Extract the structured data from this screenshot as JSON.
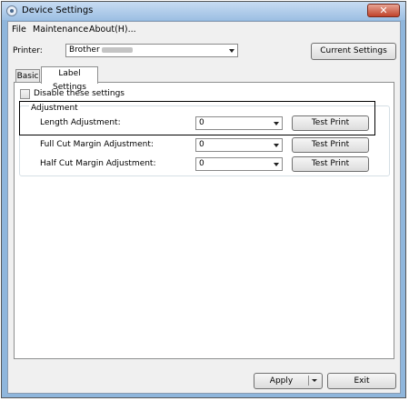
{
  "window": {
    "title": "Device Settings",
    "close_symbol": "✕"
  },
  "menu": [
    "File",
    "Maintenance",
    "About(H)..."
  ],
  "printer": {
    "label": "Printer:",
    "value": "Brother",
    "current_settings_button": "Current Settings"
  },
  "tabs": [
    "Basic",
    "Label Settings"
  ],
  "disable_settings_label": "Disable these settings",
  "adjustment": {
    "group_title": "Adjustment",
    "rows": [
      {
        "label": "Length Adjustment:",
        "value": "0",
        "button": "Test Print"
      },
      {
        "label": "Full Cut Margin Adjustment:",
        "value": "0",
        "button": "Test Print"
      },
      {
        "label": "Half Cut Margin Adjustment:",
        "value": "0",
        "button": "Test Print"
      }
    ]
  },
  "footer": {
    "apply_button": "Apply",
    "exit_button": "Exit"
  }
}
